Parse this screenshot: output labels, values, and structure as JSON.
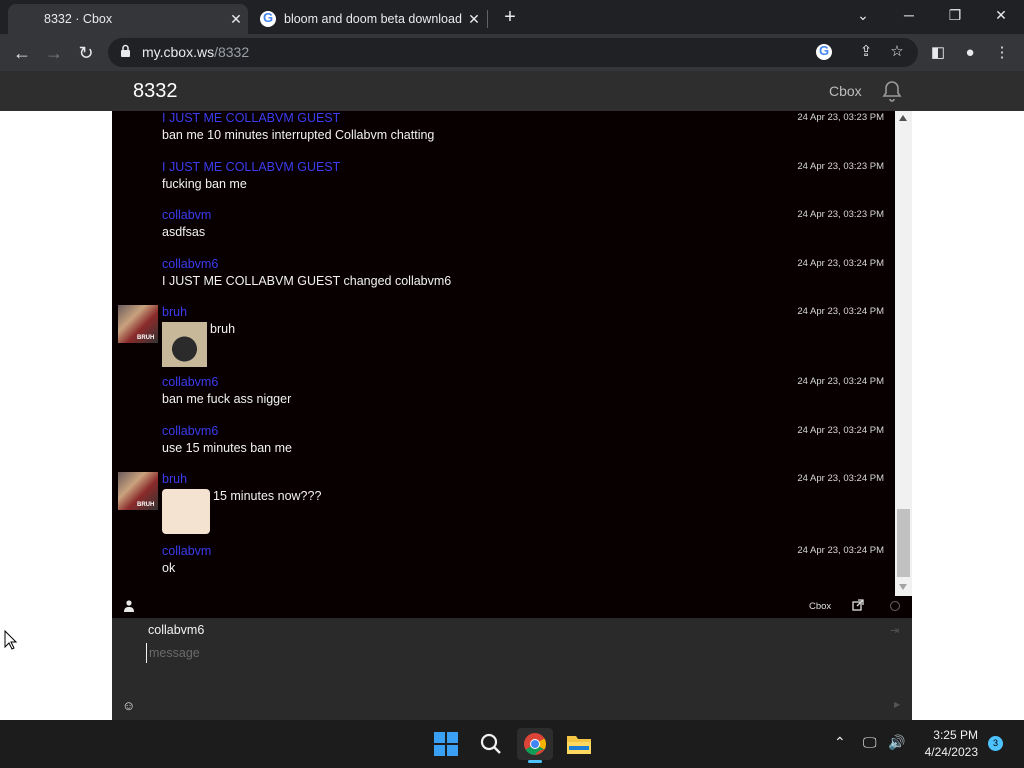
{
  "browser": {
    "tabs": [
      {
        "title": "8332 · Cbox",
        "active": true
      },
      {
        "title": "bloom and doom beta download",
        "active": false
      }
    ],
    "url_host": "my.cbox.ws",
    "url_path": "/8332"
  },
  "header": {
    "title": "8332",
    "brand": "Cbox"
  },
  "messages": [
    {
      "user": "I JUST ME COLLABVM GUEST",
      "time": "24 Apr 23, 03:23 PM",
      "text": "ban me 10 minutes interrupted Collabvm chatting"
    },
    {
      "user": "I JUST ME COLLABVM GUEST",
      "time": "24 Apr 23, 03:23 PM",
      "text": "fucking ban me"
    },
    {
      "user": "collabvm",
      "time": "24 Apr 23, 03:23 PM",
      "text": "asdfsas"
    },
    {
      "user": "collabvm6",
      "time": "24 Apr 23, 03:24 PM",
      "text": "I JUST ME COLLABVM GUEST changed collabvm6"
    },
    {
      "user": "bruh",
      "time": "24 Apr 23, 03:24 PM",
      "text": "bruh",
      "avatar_text": "BRUH"
    },
    {
      "user": "collabvm6",
      "time": "24 Apr 23, 03:24 PM",
      "text": "ban me fuck ass nigger"
    },
    {
      "user": "collabvm6",
      "time": "24 Apr 23, 03:24 PM",
      "text": "use 15 minutes ban me"
    },
    {
      "user": "bruh",
      "time": "24 Apr 23, 03:24 PM",
      "text": "15 minutes now???",
      "avatar_text": "BRUH"
    },
    {
      "user": "collabvm",
      "time": "24 Apr 23, 03:24 PM",
      "text": "ok"
    }
  ],
  "chatbar": {
    "brand": "Cbox"
  },
  "input": {
    "username": "collabvm6",
    "placeholder": "message"
  },
  "taskbar": {
    "time": "3:25 PM",
    "date": "4/24/2023",
    "notifications": "3"
  },
  "colors": {
    "username": "#3c3cf0",
    "chat_bg": "#080000",
    "input_bg": "#2a2a2a"
  }
}
